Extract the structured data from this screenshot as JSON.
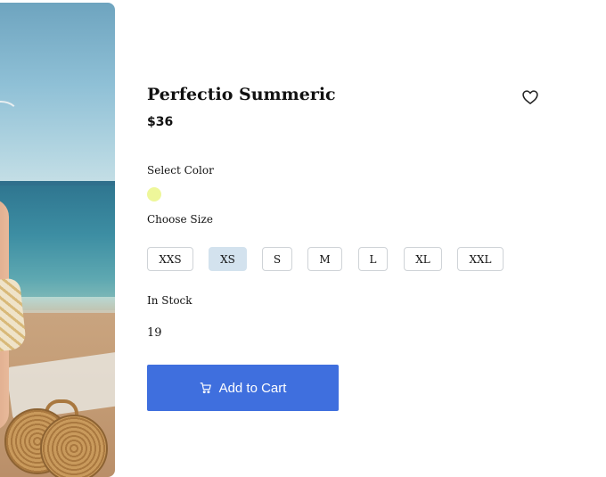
{
  "product": {
    "image_alt": "woman-on-beach-photo",
    "title": "Perfectio Summeric",
    "price": "$36",
    "wishlist_icon": "heart-outline-icon"
  },
  "color": {
    "label": "Select Color",
    "swatches": [
      {
        "value": "#eef79a",
        "selected": true
      }
    ]
  },
  "size": {
    "label": "Choose Size",
    "options": [
      "XXS",
      "XS",
      "S",
      "M",
      "L",
      "XL",
      "XXL"
    ],
    "selected": "XS"
  },
  "stock": {
    "label": "In Stock",
    "quantity": "19"
  },
  "cart": {
    "button_label": "Add to Cart",
    "icon": "cart-icon",
    "button_color": "#3f6fde"
  }
}
